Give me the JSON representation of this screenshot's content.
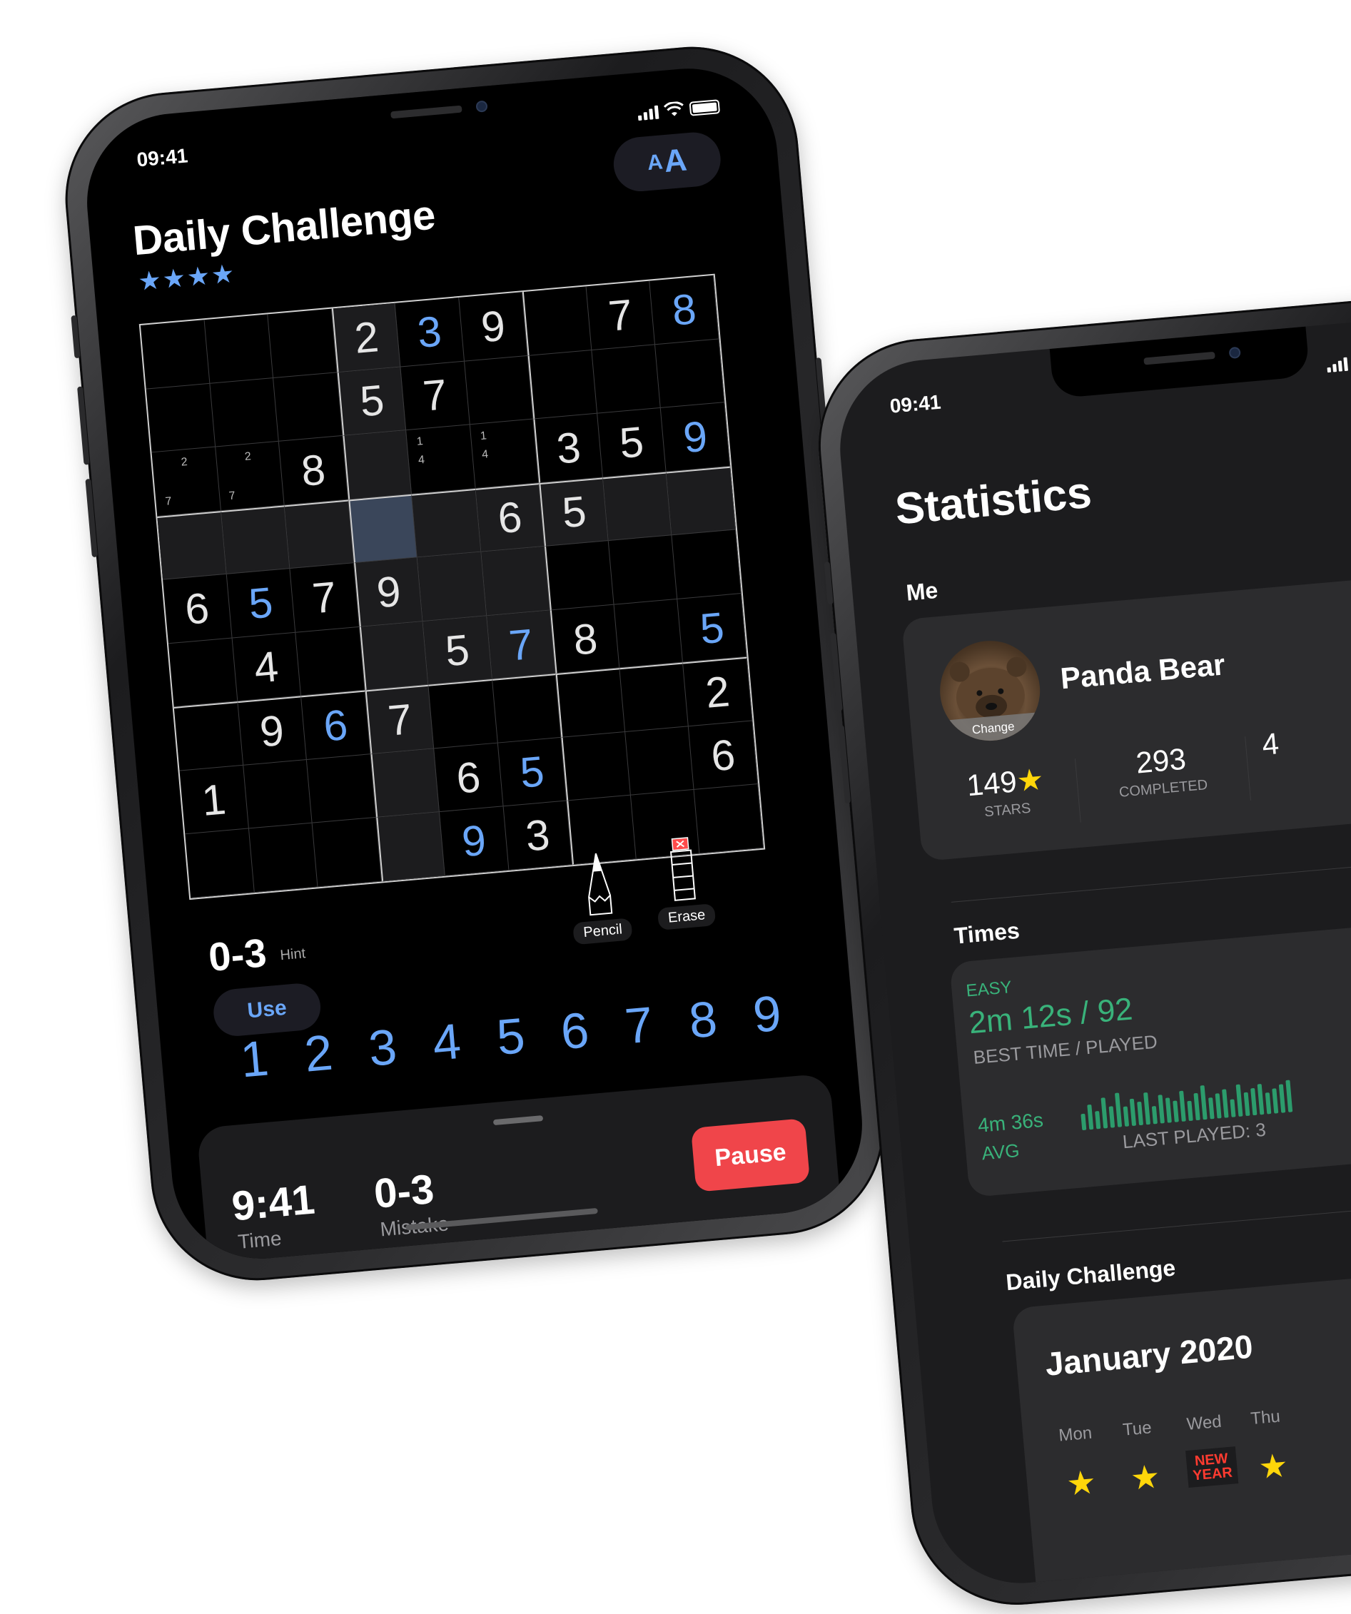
{
  "game": {
    "status_time": "09:41",
    "title": "Daily Challenge",
    "stars": "★★★★",
    "font_button": {
      "small": "A",
      "big": "A"
    },
    "board": [
      [
        {
          "v": ""
        },
        {
          "v": ""
        },
        {
          "v": ""
        },
        {
          "v": "2"
        },
        {
          "v": "3",
          "u": true
        },
        {
          "v": "9"
        },
        {
          "v": ""
        },
        {
          "v": "7"
        },
        {
          "v": "8",
          "u": true
        }
      ],
      [
        {
          "v": ""
        },
        {
          "v": ""
        },
        {
          "v": ""
        },
        {
          "v": "5"
        },
        {
          "v": "7"
        },
        {
          "v": ""
        },
        {
          "v": ""
        },
        {
          "v": ""
        },
        {
          "v": ""
        }
      ],
      [
        {
          "n": [
            "",
            "2",
            "",
            "",
            "",
            "",
            "7",
            "",
            ""
          ]
        },
        {
          "n": [
            "",
            "2",
            "",
            "",
            "",
            "",
            "7",
            "",
            ""
          ]
        },
        {
          "v": "8"
        },
        {
          "v": ""
        },
        {
          "n": [
            "1",
            "",
            "",
            "4",
            "",
            "",
            "",
            "",
            ""
          ]
        },
        {
          "n": [
            "1",
            "",
            "",
            "4",
            "",
            "",
            "",
            "",
            ""
          ]
        },
        {
          "v": "3"
        },
        {
          "v": "5"
        },
        {
          "v": "9",
          "u": true
        }
      ],
      [
        {
          "v": ""
        },
        {
          "v": ""
        },
        {
          "v": ""
        },
        {
          "v": "",
          "sel": true
        },
        {
          "v": ""
        },
        {
          "v": "6"
        },
        {
          "v": "5"
        },
        {
          "v": ""
        },
        {
          "v": ""
        }
      ],
      [
        {
          "v": "6"
        },
        {
          "v": "5",
          "u": true
        },
        {
          "v": "7"
        },
        {
          "v": "9"
        },
        {
          "v": ""
        },
        {
          "v": ""
        },
        {
          "v": ""
        },
        {
          "v": ""
        },
        {
          "v": ""
        }
      ],
      [
        {
          "v": ""
        },
        {
          "v": "4"
        },
        {
          "v": ""
        },
        {
          "v": ""
        },
        {
          "v": "5"
        },
        {
          "v": "7",
          "u": true
        },
        {
          "v": "8"
        },
        {
          "v": ""
        },
        {
          "v": "5",
          "u": true
        }
      ],
      [
        {
          "v": ""
        },
        {
          "v": "9"
        },
        {
          "v": "6",
          "u": true
        },
        {
          "v": "7"
        },
        {
          "v": ""
        },
        {
          "v": ""
        },
        {
          "v": ""
        },
        {
          "v": ""
        },
        {
          "v": "2"
        }
      ],
      [
        {
          "v": "1"
        },
        {
          "v": ""
        },
        {
          "v": ""
        },
        {
          "v": ""
        },
        {
          "v": "6"
        },
        {
          "v": "5",
          "u": true
        },
        {
          "v": ""
        },
        {
          "v": ""
        },
        {
          "v": "6"
        }
      ],
      [
        {
          "v": ""
        },
        {
          "v": ""
        },
        {
          "v": ""
        },
        {
          "v": ""
        },
        {
          "v": "9",
          "u": true
        },
        {
          "v": "3"
        },
        {
          "v": ""
        },
        {
          "v": ""
        },
        {
          "v": ""
        }
      ]
    ],
    "hint_value": "0-3",
    "hint_label": "Hint",
    "use_label": "Use",
    "pencil_label": "Pencil",
    "erase_label": "Erase",
    "numpad": [
      "1",
      "2",
      "3",
      "4",
      "5",
      "6",
      "7",
      "8",
      "9"
    ],
    "time_value": "9:41",
    "time_label": "Time",
    "mistake_value": "0-3",
    "mistake_label": "Mistake",
    "pause_label": "Pause"
  },
  "stats": {
    "status_time": "09:41",
    "title": "Statistics",
    "me_header": "Me",
    "avatar_change": "Change",
    "username": "Panda Bear",
    "stars_value": "149",
    "stars_star": "★",
    "stars_label": "STARS",
    "completed_value": "293",
    "completed_label": "COMPLETED",
    "third_value": "4",
    "times_header": "Times",
    "easy_label": "EASY",
    "best_time": "2m 12s / 92",
    "best_label": "BEST TIME / PLAYED",
    "avg_value": "4m 36s",
    "avg_label": "AVG",
    "last_played": "LAST PLAYED: 3",
    "bars": [
      0.45,
      0.7,
      0.5,
      0.85,
      0.6,
      0.95,
      0.55,
      0.75,
      0.65,
      0.9,
      0.5,
      0.8,
      0.7,
      0.6,
      0.85,
      0.55,
      0.75,
      0.95,
      0.6,
      0.7,
      0.8,
      0.5,
      0.9,
      0.65,
      0.75,
      0.85,
      0.6,
      0.7,
      0.8,
      0.9
    ],
    "daily_header": "Daily Challenge",
    "month": "January 2020",
    "days": [
      "Mon",
      "Tue",
      "Wed",
      "Thu"
    ],
    "new_year": "NEW YEAR",
    "colors": {
      "accent_blue": "#6aa6f8",
      "pause_red": "#f0454a",
      "green": "#39b27a",
      "gold": "#ffd60a"
    }
  }
}
